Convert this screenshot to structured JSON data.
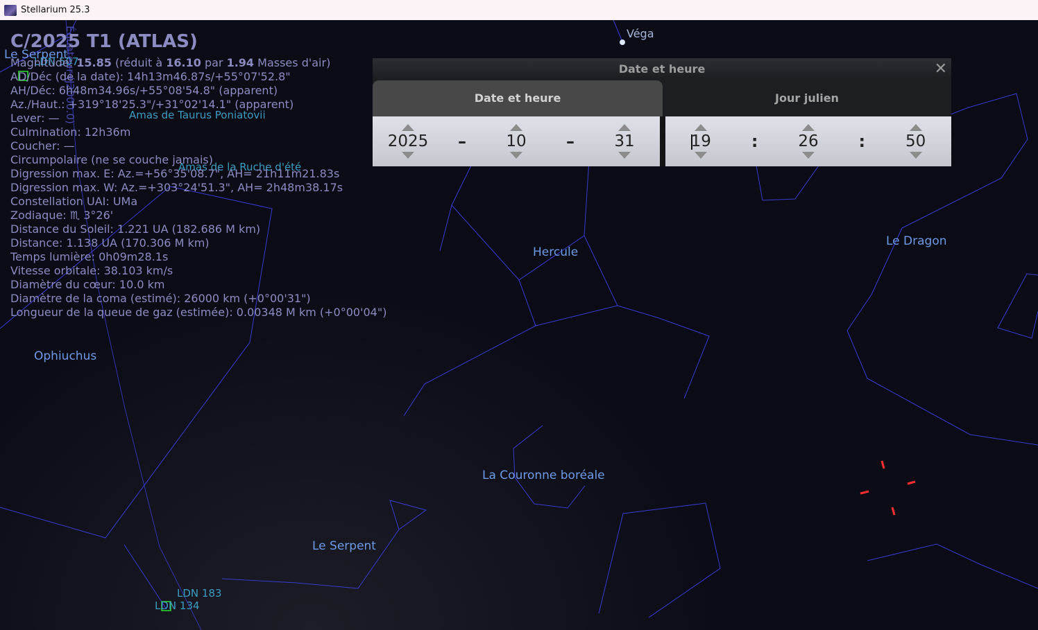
{
  "window": {
    "title": "Stellarium 25.3"
  },
  "object": {
    "name": "C/2025 T1 (ATLAS)",
    "magnitude": {
      "prefix": "Magnitude: ",
      "mag": "15.85",
      "mid": " (réduit à ",
      "reduced": "16.10",
      "par": " par ",
      "airmass": "1.94",
      "suffix": " Masses d'air)"
    },
    "lines": [
      "AD/Déc (de la date): 14h13m46.87s/+55°07'52.8\"",
      "AH/Déc: 6h48m34.96s/+55°08'54.8\" (apparent)",
      "Az./Haut.: +319°18'25.3\"/+31°02'14.1\" (apparent)",
      "Lever: —",
      "Culmination: 12h36m",
      "Coucher: —",
      "Circumpolaire (ne se couche jamais)",
      "Digression max. E: Az.=+56°35'08.7\", AH= 21h11m21.83s",
      "Digression max. W: Az.=+303°24'51.3\", AH= 2h48m38.17s",
      "Constellation UAI: UMa",
      "Zodiaque: ♏ 3°26'",
      "Distance du Soleil: 1.221 UA (182.686 M km)",
      "Distance: 1.138 UA (170.306 M km)",
      "Temps lumière: 0h09m28.1s",
      "Vitesse orbitale: 38.103 km/s",
      "Diamètre du cœur: 10.0 km",
      "Diamètre de la coma (estimé): 26000 km (+0°00'31\")",
      "Longueur de la queue de gaz (estimée): 0.00348 M km (+0°00'04\")"
    ]
  },
  "sky": {
    "equator_label": "Équateur (J2000.0)",
    "labels": {
      "vega": "Véga",
      "serpent_top": "Le Serpent",
      "ldn507": "LDN 507",
      "taurus": "Amas de Taurus Poniatovii",
      "ruche": "Amas de la Ruche d'été",
      "ophiuchus": "Ophiuchus",
      "hercule": "Hercule",
      "dragon": "Le Dragon",
      "couronne": "La Couronne boréale",
      "serpent": "Le Serpent",
      "ldn183": "LDN 183",
      "ldn134": "LDN 134"
    },
    "colors": {
      "constellation_line": "#3b3bd0",
      "constellation_label": "#6f9ae6",
      "nebula_label": "#3d9cc0",
      "info_text": "#8c8cc2"
    }
  },
  "dialog": {
    "title": "Date et heure",
    "close_icon": "close-icon",
    "tabs": [
      "Date et heure",
      "Jour julien"
    ],
    "active_tab": 0,
    "date": {
      "year": "2025",
      "month": "10",
      "day": "31",
      "sep": "–"
    },
    "time": {
      "hour": "19",
      "minute": "26",
      "second": "50",
      "sep": ":"
    }
  }
}
